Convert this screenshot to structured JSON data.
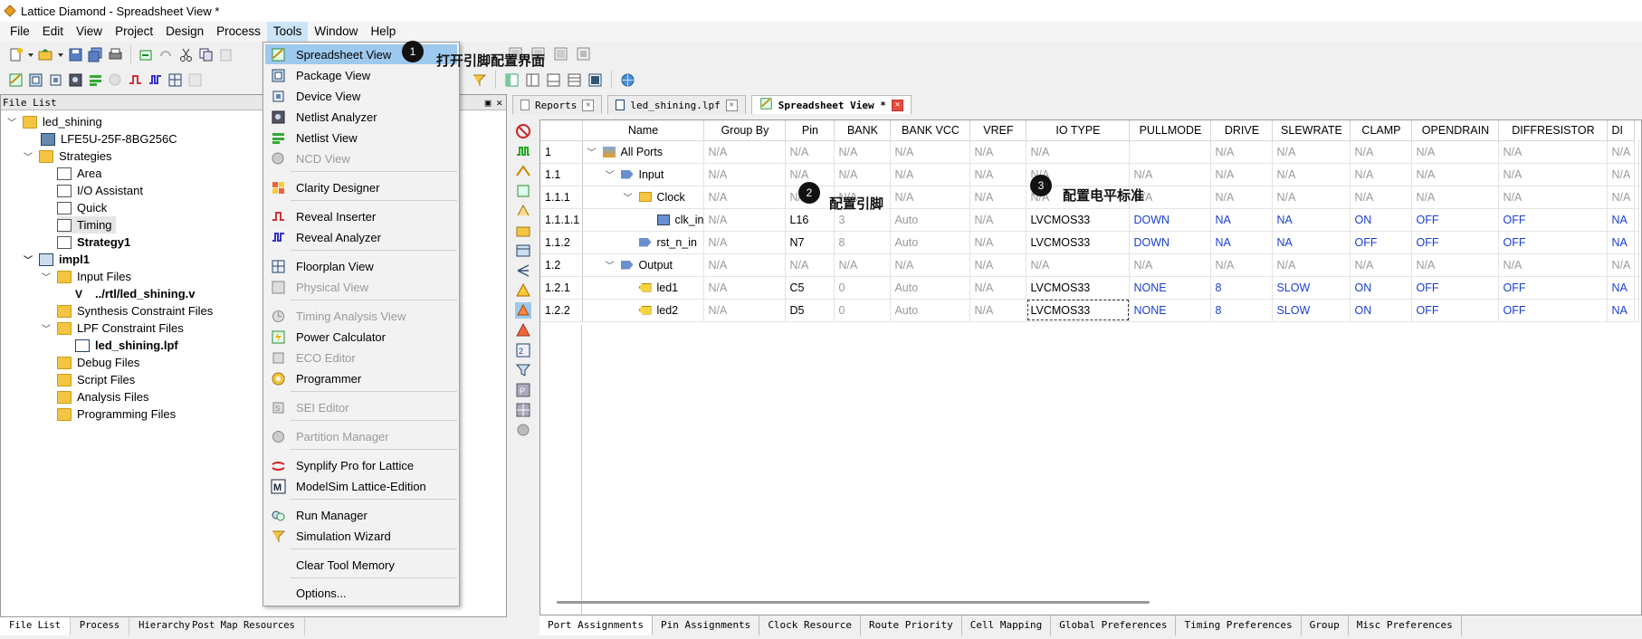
{
  "window": {
    "title": "Lattice Diamond - Spreadsheet View *"
  },
  "menubar": [
    "File",
    "Edit",
    "View",
    "Project",
    "Design",
    "Process",
    "Tools",
    "Window",
    "Help"
  ],
  "tools_menu": {
    "items": [
      {
        "label": "Spreadsheet View",
        "icon": "spreadsheet-icon",
        "enabled": true,
        "highlighted": true
      },
      {
        "label": "Package View",
        "icon": "package-icon",
        "enabled": true
      },
      {
        "label": "Device View",
        "icon": "device-icon",
        "enabled": true
      },
      {
        "label": "Netlist Analyzer",
        "icon": "netlist-analyzer-icon",
        "enabled": true
      },
      {
        "label": "Netlist View",
        "icon": "netlist-view-icon",
        "enabled": true
      },
      {
        "label": "NCD View",
        "icon": "ncd-icon",
        "enabled": false
      },
      {
        "label": "Clarity Designer",
        "icon": "clarity-icon",
        "enabled": true
      },
      {
        "label": "Reveal Inserter",
        "icon": "reveal-inserter-icon",
        "enabled": true
      },
      {
        "label": "Reveal Analyzer",
        "icon": "reveal-analyzer-icon",
        "enabled": true
      },
      {
        "label": "Floorplan View",
        "icon": "floorplan-icon",
        "enabled": true
      },
      {
        "label": "Physical View",
        "icon": "physical-icon",
        "enabled": false
      },
      {
        "label": "Timing Analysis View",
        "icon": "timing-analysis-icon",
        "enabled": false
      },
      {
        "label": "Power Calculator",
        "icon": "power-icon",
        "enabled": true
      },
      {
        "label": "ECO Editor",
        "icon": "eco-icon",
        "enabled": false
      },
      {
        "label": "Programmer",
        "icon": "programmer-icon",
        "enabled": true
      },
      {
        "label": "SEI Editor",
        "icon": "sei-icon",
        "enabled": false
      },
      {
        "label": "Partition Manager",
        "icon": "partition-icon",
        "enabled": false
      },
      {
        "label": "Synplify Pro for Lattice",
        "icon": "synplify-icon",
        "enabled": true
      },
      {
        "label": "ModelSim Lattice-Edition",
        "icon": "modelsim-icon",
        "enabled": true
      },
      {
        "label": "Run Manager",
        "icon": "run-manager-icon",
        "enabled": true
      },
      {
        "label": "Simulation Wizard",
        "icon": "sim-wizard-icon",
        "enabled": true
      },
      {
        "label": "Clear Tool Memory",
        "icon": "",
        "enabled": true
      },
      {
        "label": "Options...",
        "icon": "",
        "enabled": true
      }
    ]
  },
  "file_list": {
    "header": "File List",
    "tree": [
      {
        "label": "led_shining",
        "bold": false
      },
      {
        "label": "LFE5U-25F-8BG256C",
        "bold": false
      },
      {
        "label": "Strategies",
        "bold": false
      },
      {
        "label": "Area",
        "bold": false
      },
      {
        "label": "I/O Assistant",
        "bold": false
      },
      {
        "label": "Quick",
        "bold": false
      },
      {
        "label": "Timing",
        "bold": false
      },
      {
        "label": "Strategy1",
        "bold": true
      },
      {
        "label": "impl1",
        "bold": true
      },
      {
        "label": "Input Files",
        "bold": false
      },
      {
        "label": "../rtl/led_shining.v",
        "bold": true
      },
      {
        "label": "Synthesis Constraint Files",
        "bold": false
      },
      {
        "label": "LPF Constraint Files",
        "bold": false
      },
      {
        "label": "led_shining.lpf",
        "bold": true
      },
      {
        "label": "Debug Files",
        "bold": false
      },
      {
        "label": "Script Files",
        "bold": false
      },
      {
        "label": "Analysis Files",
        "bold": false
      },
      {
        "label": "Programming Files",
        "bold": false
      }
    ],
    "bottom_tabs": [
      "File List",
      "Process",
      "Hierarchy",
      "Post Map Resources"
    ]
  },
  "doc_tabs": [
    {
      "label": "Reports"
    },
    {
      "label": "led_shining.lpf"
    },
    {
      "label": "Spreadsheet View *"
    }
  ],
  "grid": {
    "columns": [
      "Name",
      "Group By",
      "Pin",
      "BANK",
      "BANK VCC",
      "VREF",
      "IO TYPE",
      "PULLMODE",
      "DRIVE",
      "SLEWRATE",
      "CLAMP",
      "OPENDRAIN",
      "DIFFRESISTOR",
      "DI"
    ],
    "rows": [
      {
        "id": "1",
        "name": "All Ports",
        "cells": [
          "N/A",
          "N/A",
          "N/A",
          "N/A",
          "N/A",
          "N/A",
          "",
          "N/A",
          "N/A",
          "N/A",
          "N/A",
          "N/A",
          "N/A"
        ]
      },
      {
        "id": "1.1",
        "name": "Input",
        "cells": [
          "N/A",
          "N/A",
          "N/A",
          "N/A",
          "N/A",
          "N/A",
          "N/A",
          "N/A",
          "N/A",
          "N/A",
          "N/A",
          "N/A",
          "N/A"
        ]
      },
      {
        "id": "1.1.1",
        "name": "Clock",
        "cells": [
          "N/A",
          "N/A",
          "N/A",
          "N/A",
          "N/A",
          "N/A",
          "N/A",
          "N/A",
          "N/A",
          "N/A",
          "N/A",
          "N/A",
          "N/A"
        ]
      },
      {
        "id": "1.1.1.1",
        "name": "clk_in",
        "cells": [
          "N/A",
          "L16",
          "3",
          "Auto",
          "N/A",
          "LVCMOS33",
          "DOWN",
          "NA",
          "NA",
          "ON",
          "OFF",
          "OFF",
          "NA"
        ]
      },
      {
        "id": "1.1.2",
        "name": "rst_n_in",
        "cells": [
          "N/A",
          "N7",
          "8",
          "Auto",
          "N/A",
          "LVCMOS33",
          "DOWN",
          "NA",
          "NA",
          "OFF",
          "OFF",
          "OFF",
          "NA"
        ]
      },
      {
        "id": "1.2",
        "name": "Output",
        "cells": [
          "N/A",
          "N/A",
          "N/A",
          "N/A",
          "N/A",
          "N/A",
          "N/A",
          "N/A",
          "N/A",
          "N/A",
          "N/A",
          "N/A",
          "N/A"
        ]
      },
      {
        "id": "1.2.1",
        "name": "led1",
        "cells": [
          "N/A",
          "C5",
          "0",
          "Auto",
          "N/A",
          "LVCMOS33",
          "NONE",
          "8",
          "SLOW",
          "ON",
          "OFF",
          "OFF",
          "NA"
        ]
      },
      {
        "id": "1.2.2",
        "name": "led2",
        "cells": [
          "N/A",
          "D5",
          "0",
          "Auto",
          "N/A",
          "LVCMOS33",
          "NONE",
          "8",
          "SLOW",
          "ON",
          "OFF",
          "OFF",
          "NA"
        ]
      }
    ]
  },
  "bottom_tabs": [
    "Port Assignments",
    "Pin Assignments",
    "Clock Resource",
    "Route Priority",
    "Cell Mapping",
    "Global Preferences",
    "Timing Preferences",
    "Group",
    "Misc Preferences"
  ],
  "annotations": [
    {
      "num": "1",
      "text": "打开引脚配置界面"
    },
    {
      "num": "2",
      "text": "配置引脚"
    },
    {
      "num": "3",
      "text": "配置电平标准"
    }
  ],
  "colors": {
    "highlight": "#9ec9ee",
    "value_blue": "#1a3fcc",
    "na_gray": "#9a9a9a"
  }
}
